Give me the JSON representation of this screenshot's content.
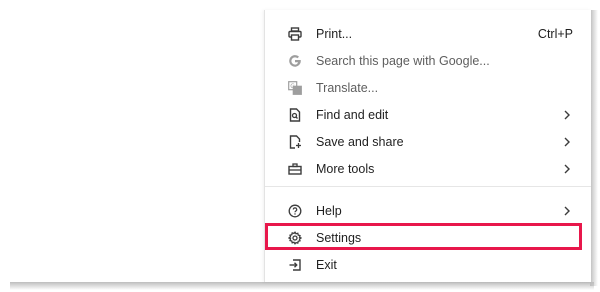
{
  "menu": {
    "items": [
      {
        "label": "Print...",
        "shortcut": "Ctrl+P",
        "icon": "printer-icon"
      },
      {
        "label": "Search this page with Google...",
        "icon": "google-g-icon"
      },
      {
        "label": "Translate...",
        "icon": "translate-icon"
      },
      {
        "label": "Find and edit",
        "icon": "find-page-icon",
        "submenu": true
      },
      {
        "label": "Save and share",
        "icon": "save-share-icon",
        "submenu": true
      },
      {
        "label": "More tools",
        "icon": "toolbox-icon",
        "submenu": true
      },
      {
        "label": "Help",
        "icon": "help-circle-icon",
        "submenu": true
      },
      {
        "label": "Settings",
        "icon": "gear-icon",
        "highlighted": true
      },
      {
        "label": "Exit",
        "icon": "exit-icon"
      }
    ]
  },
  "colors": {
    "highlight_border": "#e8174b",
    "text": "#1f1f1f",
    "disabled_text": "#5e5e5e",
    "icon": "#3c3c3c"
  }
}
